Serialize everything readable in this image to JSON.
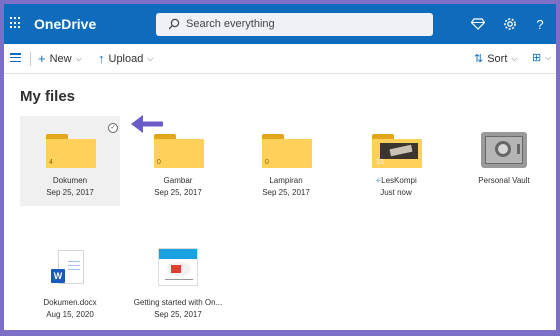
{
  "app": {
    "name": "OneDrive"
  },
  "search": {
    "placeholder": "Search everything"
  },
  "toolbar": {
    "new_label": "New",
    "upload_label": "Upload",
    "sort_label": "Sort"
  },
  "page": {
    "title": "My files"
  },
  "items": [
    {
      "name": "Dokumen",
      "date": "Sep 25, 2017",
      "type": "folder",
      "count": "4",
      "selected": true
    },
    {
      "name": "Gambar",
      "date": "Sep 25, 2017",
      "type": "folder",
      "count": "0"
    },
    {
      "name": "Lampiran",
      "date": "Sep 25, 2017",
      "type": "folder",
      "count": "0"
    },
    {
      "name": "LesKompi",
      "date": "Just now",
      "type": "folder-photo",
      "count": "13"
    },
    {
      "name": "Personal Vault",
      "date": "",
      "type": "vault"
    },
    {
      "name": "Dokumen.docx",
      "date": "Aug 15, 2020",
      "type": "word-doc"
    },
    {
      "name": "Getting started with On...",
      "date": "Sep 25, 2017",
      "type": "pdf-thumb"
    }
  ],
  "colors": {
    "brand": "#0f6cbd",
    "folder": "#ffd05a",
    "arrow": "#6b5bc4",
    "frame": "#7b6fc7"
  }
}
